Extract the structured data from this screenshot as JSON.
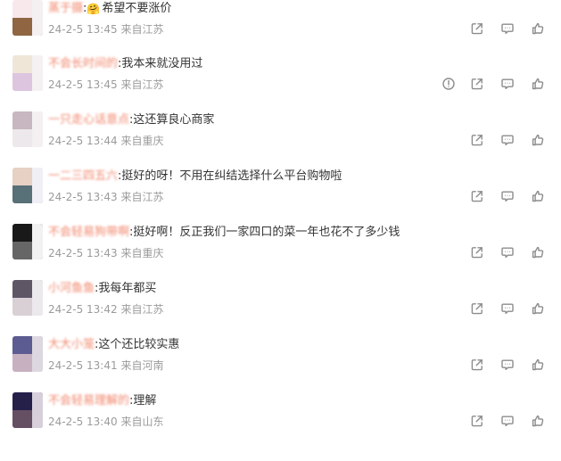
{
  "comments": [
    {
      "name": "蒸于摄 ",
      "text": "希望不要涨价",
      "emoji": "hugging-face-emoji",
      "date": "24-2-5 13:45",
      "source": "来自江苏",
      "show_report": false,
      "avatar_colors": [
        "#f8e8ec",
        "#8f6542",
        "#f4f0f1"
      ]
    },
    {
      "name": "不会长时间的",
      "text": "我本来就没用过",
      "emoji": "",
      "date": "24-2-5 13:45",
      "source": "来自江苏",
      "show_report": true,
      "avatar_colors": [
        "#efe6d8",
        "#ddc5df",
        "#f5f1f3"
      ]
    },
    {
      "name": "一只走心话意点",
      "text": "这还算良心商家",
      "emoji": "",
      "date": "24-2-5 13:44",
      "source": "来自重庆",
      "show_report": false,
      "avatar_colors": [
        "#c8b7c0",
        "#ede8ec",
        "#f4f0f2"
      ]
    },
    {
      "name": "一二三四五六",
      "text": "挺好的呀！不用在纠结选择什么平台购物啦",
      "emoji": "",
      "date": "24-2-5 13:43",
      "source": "来自江苏",
      "show_report": false,
      "avatar_colors": [
        "#e7d0c4",
        "#587077",
        "#efeff5"
      ]
    },
    {
      "name": "不会轻易狗带啊",
      "text": "挺好啊！反正我们一家四口的菜一年也花不了多少钱",
      "emoji": "",
      "date": "24-2-5 13:43",
      "source": "来自重庆",
      "show_report": false,
      "avatar_colors": [
        "#191919",
        "#666666",
        "#f1f1f1"
      ]
    },
    {
      "name": "小河鱼鱼",
      "text": "我每年都买",
      "emoji": "",
      "date": "24-2-5 13:42",
      "source": "来自江苏",
      "show_report": false,
      "avatar_colors": [
        "#5e5665",
        "#d8d0d4",
        "#ece9ec"
      ]
    },
    {
      "name": "大大小笼",
      "text": "这个还比较实惠",
      "emoji": "",
      "date": "24-2-5 13:41",
      "source": "来自河南",
      "show_report": false,
      "avatar_colors": [
        "#5c5c92",
        "#c7b1c0",
        "#ddd7df"
      ]
    },
    {
      "name": "不会轻易理解的",
      "text": "理解",
      "emoji": "",
      "date": "24-2-5 13:40",
      "source": "来自山东",
      "show_report": false,
      "avatar_colors": [
        "#24204a",
        "#655063",
        "#d7d0db"
      ]
    }
  ],
  "action_icons": {
    "share": "share-icon",
    "comment": "comment-icon",
    "like": "like-icon",
    "report": "report-icon"
  },
  "colors": {
    "name": "#f07a5d",
    "text": "#333333",
    "meta": "#9b9b9b",
    "icon": "#8c8c8c"
  }
}
